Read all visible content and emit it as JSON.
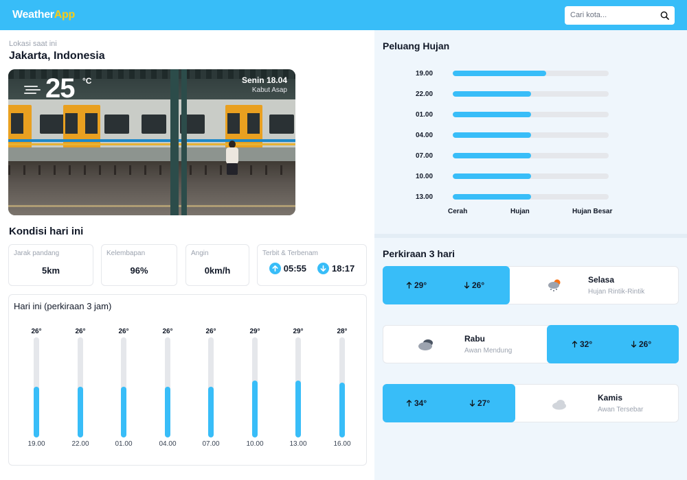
{
  "header": {
    "logo_main": "Weather",
    "logo_accent": "App",
    "search_placeholder": "Cari kota..."
  },
  "location": {
    "label": "Lokasi saat ini",
    "name": "Jakarta, Indonesia"
  },
  "current": {
    "temp": "25",
    "unit": "°C",
    "date": "Senin 18.04",
    "desc": "Kabut Asap"
  },
  "conditions": {
    "title": "Kondisi hari ini",
    "visibility": {
      "label": "Jarak pandang",
      "value": "5km"
    },
    "humidity": {
      "label": "Kelembapan",
      "value": "96%"
    },
    "wind": {
      "label": "Angin",
      "value": "0km/h"
    },
    "sun": {
      "label": "Terbit & Terbenam",
      "sunrise": "05:55",
      "sunset": "18:17"
    }
  },
  "hourly": {
    "title": "Hari ini (perkiraan 3 jam)",
    "items": [
      {
        "time": "19.00",
        "temp": "26°",
        "level": 0.51
      },
      {
        "time": "22.00",
        "temp": "26°",
        "level": 0.51
      },
      {
        "time": "01.00",
        "temp": "26°",
        "level": 0.51
      },
      {
        "time": "04.00",
        "temp": "26°",
        "level": 0.51
      },
      {
        "time": "07.00",
        "temp": "26°",
        "level": 0.51
      },
      {
        "time": "10.00",
        "temp": "29°",
        "level": 0.57
      },
      {
        "time": "13.00",
        "temp": "29°",
        "level": 0.57
      },
      {
        "time": "16.00",
        "temp": "28°",
        "level": 0.55
      }
    ]
  },
  "rain": {
    "title": "Peluang Hujan",
    "items": [
      {
        "time": "19.00",
        "level": 0.6
      },
      {
        "time": "22.00",
        "level": 0.5
      },
      {
        "time": "01.00",
        "level": 0.5
      },
      {
        "time": "04.00",
        "level": 0.5
      },
      {
        "time": "07.00",
        "level": 0.5
      },
      {
        "time": "10.00",
        "level": 0.5
      },
      {
        "time": "13.00",
        "level": 0.5
      }
    ],
    "legend": [
      "Cerah",
      "Hujan",
      "Hujan Besar"
    ]
  },
  "forecast": {
    "title": "Perkiraan 3 hari",
    "days": [
      {
        "day": "Selasa",
        "desc": "Hujan Rintik-Rintik",
        "high": "29°",
        "low": "26°",
        "icon": "rain-cloud-icon"
      },
      {
        "day": "Rabu",
        "desc": "Awan Mendung",
        "high": "32°",
        "low": "26°",
        "icon": "dark-cloud-icon"
      },
      {
        "day": "Kamis",
        "desc": "Awan Tersebar",
        "high": "34°",
        "low": "27°",
        "icon": "cloud-icon"
      }
    ]
  },
  "colors": {
    "accent": "#38bdf8",
    "logo_accent": "#facc15",
    "track": "#e5e7eb"
  }
}
